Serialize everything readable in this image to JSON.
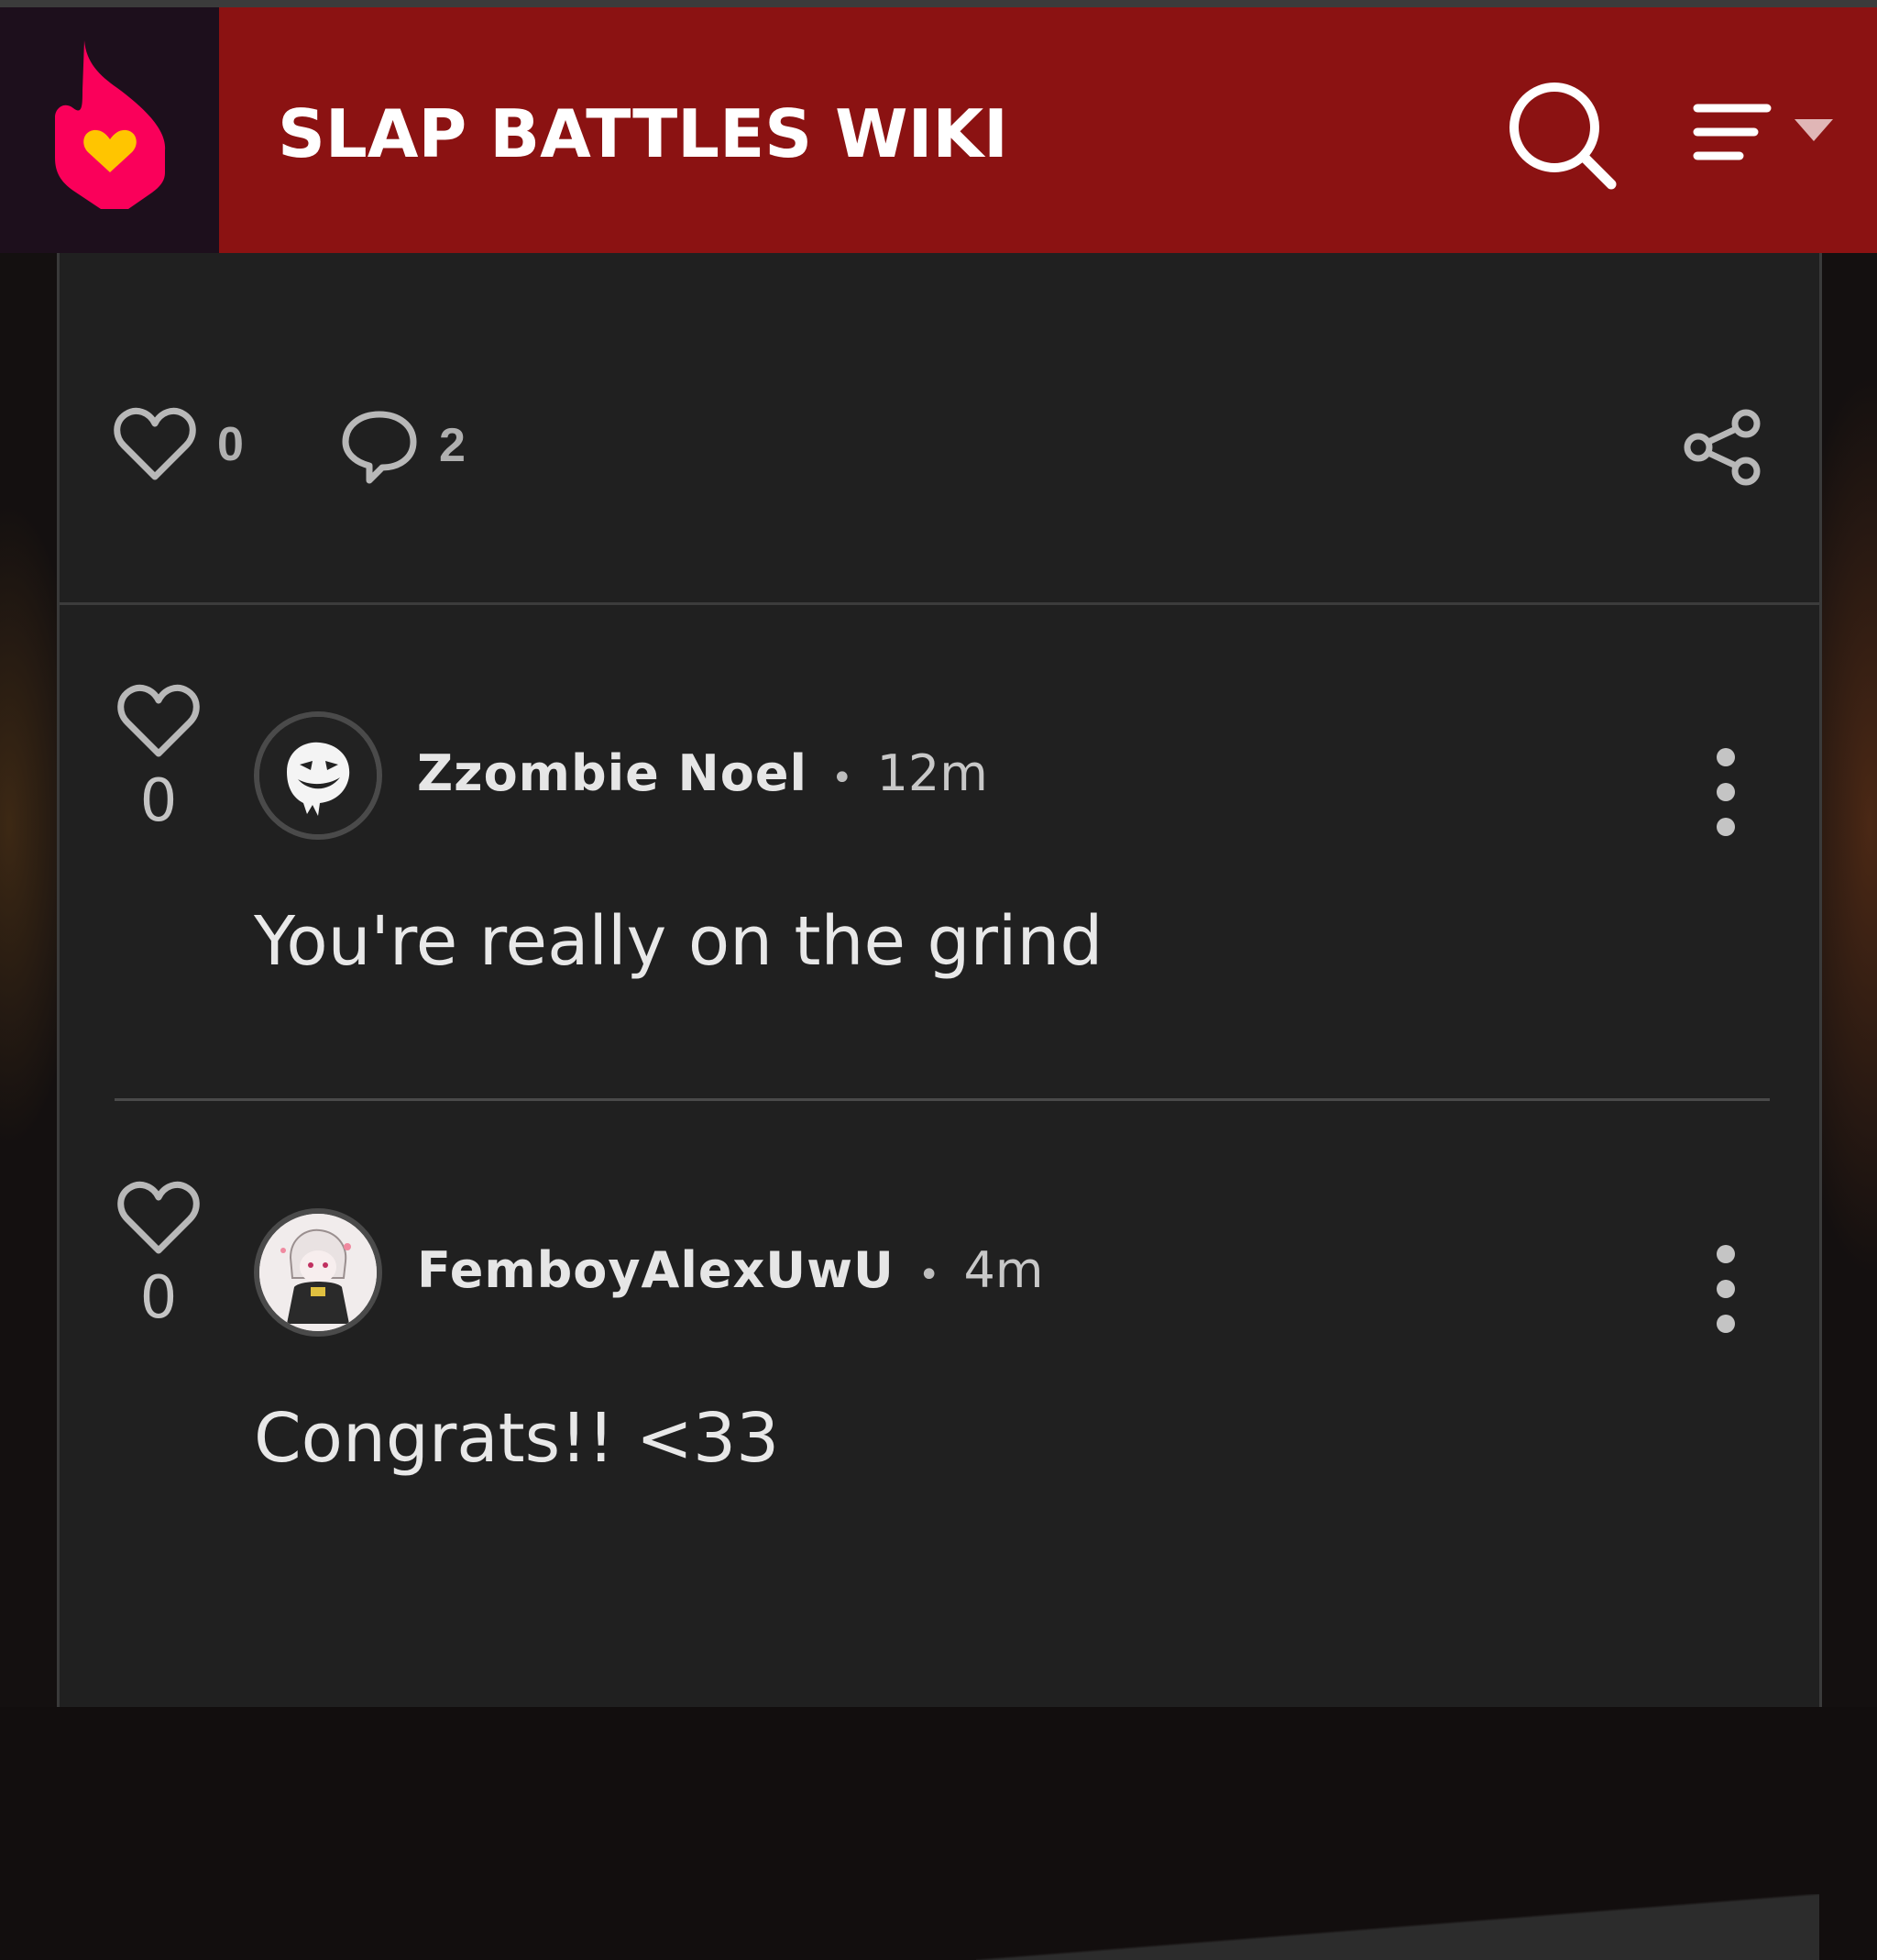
{
  "header": {
    "wiki_title": "SLAP BATTLES WIKI",
    "logo_icon": "fandom-logo-icon",
    "search_icon": "search-icon",
    "menu_icon": "menu-icon",
    "menu_caret_icon": "chevron-down-icon",
    "background_color": "#8b1212",
    "logo_background_color": "#1d0f1c"
  },
  "post_actions": {
    "like_count": "0",
    "comment_count": "2",
    "share_icon": "share-icon"
  },
  "comments": [
    {
      "username": "Zzombie Noel",
      "separator": "•",
      "time": "12m",
      "likes": "0",
      "text": "You're really on the grind"
    },
    {
      "username": "FemboyAlexUwU",
      "separator": "•",
      "time": "4m",
      "likes": "0",
      "text": "Congrats!! <33"
    }
  ],
  "colors": {
    "card_background": "#202020",
    "accent_logo_pink": "#fa005a",
    "accent_logo_yellow": "#ffc500"
  }
}
